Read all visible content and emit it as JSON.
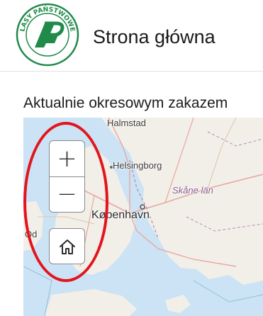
{
  "header": {
    "logo_text": "LASY PAŃSTWOWE",
    "title": "Strona główna"
  },
  "notice": {
    "text": "Aktualnie okresowym zakazem"
  },
  "map": {
    "places": {
      "halmstad": "Halmstad",
      "helsingborg": "Helsingborg",
      "skane": "Skåne län",
      "kobenhavn": "København",
      "odense": "Od"
    },
    "controls": {
      "zoom_in": "+",
      "zoom_out": "−"
    }
  },
  "colors": {
    "sea": "#cbe3f4",
    "land": "#f2efe9",
    "logo_green": "#1f8a4a",
    "annotation": "#e3141d"
  }
}
